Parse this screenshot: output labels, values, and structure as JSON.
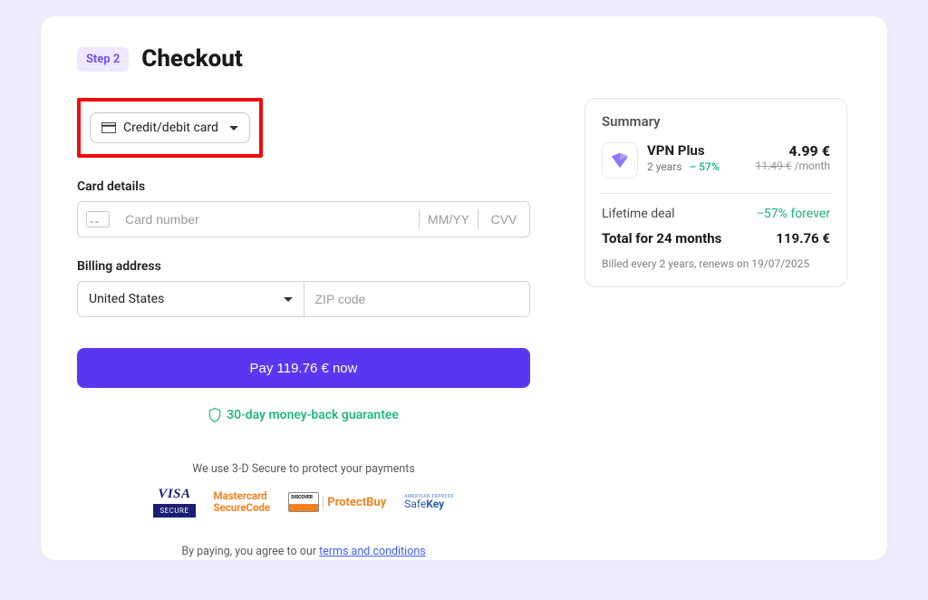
{
  "step_label": "Step 2",
  "title": "Checkout",
  "payment_method": {
    "label": "Credit/debit card"
  },
  "card_section_label": "Card details",
  "card_number_placeholder": "Card number",
  "card_expiry_placeholder": "MM/YY",
  "card_cvv_placeholder": "CVV",
  "billing_section_label": "Billing address",
  "country": "United States",
  "zip_placeholder": "ZIP code",
  "pay_button": "Pay 119.76 € now",
  "guarantee": "30-day money-back guarantee",
  "secure_note": "We use 3-D Secure to protect your payments",
  "badges": {
    "visa_top": "VISA",
    "visa_secure": "SECURE",
    "mc_line1": "Mastercard",
    "mc_line2": "SecureCode",
    "protectbuy": "ProtectBuy",
    "safekey_top": "AMERICAN EXPRESS",
    "safekey": "SafeKey"
  },
  "terms_prefix": "By paying, you agree to our ",
  "terms_link": "terms and conditions",
  "summary": {
    "title": "Summary",
    "plan_name": "VPN Plus",
    "plan_term": "2 years",
    "plan_discount": "– 57%",
    "price": "4.99 €",
    "old_price": "11.49 €",
    "per": "/month",
    "line1_label": "Lifetime deal",
    "line1_value": "−57% forever",
    "total_label": "Total for 24 months",
    "total_value": "119.76 €",
    "footer": "Billed every 2 years, renews on 19/07/2025"
  }
}
